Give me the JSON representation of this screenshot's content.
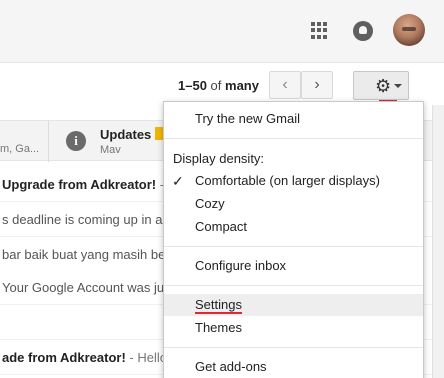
{
  "header": {
    "apps_icon": "apps-grid-icon",
    "notifications_icon": "notifications-icon",
    "avatar": "account-avatar"
  },
  "toolbar": {
    "pager_range": "1–50",
    "pager_of": "of",
    "pager_total": "many",
    "prev_icon": "‹",
    "next_icon": "›",
    "settings_icon": "⚙",
    "accent_color": "#e32636"
  },
  "tabs": {
    "left_partial": "m, Ga...",
    "updates_title": "Updates",
    "updates_sub": "Mav",
    "updates_badge_color": "#f4b400"
  },
  "emails": [
    {
      "text": "Upgrade from Adkreator!",
      "snippet": " -",
      "bold": true
    },
    {
      "text": "s deadline is coming up in a fe",
      "snippet": "",
      "bold": false
    },
    {
      "text": "bar baik buat yang masih ber",
      "snippet": "",
      "bold": false
    },
    {
      "text": " Your Google Account was jus",
      "snippet": "",
      "bold": false
    },
    {
      "text": "",
      "snippet": "",
      "bold": false
    },
    {
      "text": "ade from Adkreator!",
      "snippet": " - Hello Y",
      "bold": true
    }
  ],
  "menu": {
    "try_new": "Try the new Gmail",
    "density_heading": "Display density:",
    "comfortable": "Comfortable (on larger displays)",
    "cozy": "Cozy",
    "compact": "Compact",
    "configure_inbox": "Configure inbox",
    "settings": "Settings",
    "themes": "Themes",
    "get_addons": "Get add-ons",
    "checkmark": "✓"
  }
}
